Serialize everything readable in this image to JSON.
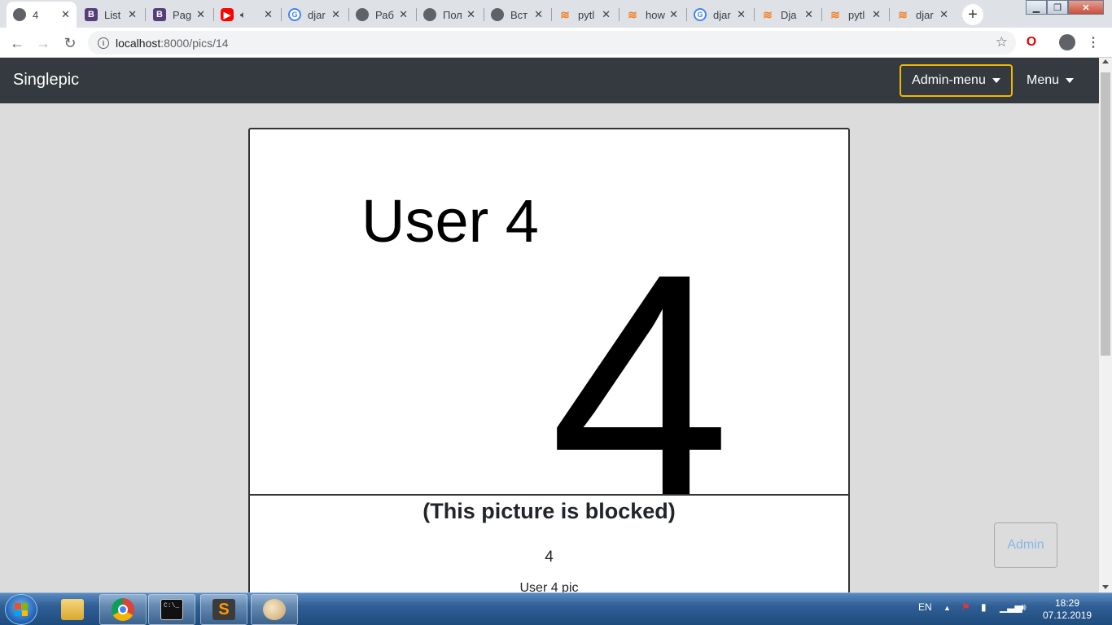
{
  "browser": {
    "tabs": [
      {
        "title": "4",
        "icon": "globe-icon",
        "active": true
      },
      {
        "title": "List",
        "icon": "bootstrap-icon"
      },
      {
        "title": "Pag",
        "icon": "bootstrap-icon"
      },
      {
        "title": "",
        "icon": "youtube-icon"
      },
      {
        "title": "djar",
        "icon": "google-icon"
      },
      {
        "title": "Раб",
        "icon": "globe-icon"
      },
      {
        "title": "Пол",
        "icon": "globe-icon"
      },
      {
        "title": "Вст",
        "icon": "globe-icon"
      },
      {
        "title": "pytl",
        "icon": "stackoverflow-icon"
      },
      {
        "title": "how",
        "icon": "stackoverflow-icon"
      },
      {
        "title": "djar",
        "icon": "google-icon"
      },
      {
        "title": "Dja",
        "icon": "stackoverflow-icon"
      },
      {
        "title": "pytl",
        "icon": "stackoverflow-icon"
      },
      {
        "title": "djar",
        "icon": "stackoverflow-icon"
      }
    ],
    "url_host": "localhost",
    "url_path": ":8000/pics/14"
  },
  "navbar": {
    "brand": "Singlepic",
    "admin_menu": "Admin-menu",
    "menu": "Menu"
  },
  "picture": {
    "image_user_text": "User 4",
    "image_number": "4",
    "blocked_label": "(This picture is blocked)",
    "id": "4",
    "description": "User 4 pic"
  },
  "admin_button": "Admin",
  "taskbar": {
    "language": "EN",
    "time": "18:29",
    "date": "07.12.2019"
  }
}
